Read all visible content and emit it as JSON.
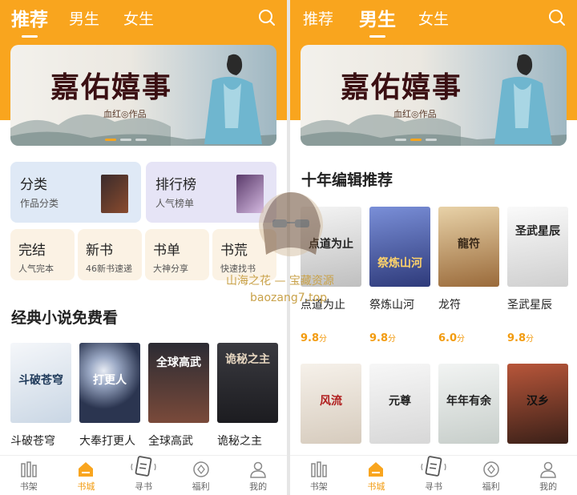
{
  "left": {
    "tabs": [
      {
        "label": "推荐",
        "active": true
      },
      {
        "label": "男生",
        "active": false
      },
      {
        "label": "女生",
        "active": false
      }
    ],
    "banner": {
      "title": "嘉佑嬉事",
      "subtitle": "血红◎作品"
    },
    "categories": [
      {
        "title": "分类",
        "sub": "作品分类"
      },
      {
        "title": "排行榜",
        "sub": "人气榜单"
      }
    ],
    "quick": [
      {
        "title": "完结",
        "sub": "人气完本"
      },
      {
        "title": "新书",
        "sub": "46新书速递"
      },
      {
        "title": "书单",
        "sub": "大神分享"
      },
      {
        "title": "书荒",
        "sub": "快速找书"
      }
    ],
    "section_title": "经典小说免费看",
    "books": [
      {
        "name": "斗破苍穹",
        "cover_text": "斗破苍穹",
        "color": "#dfe7ef"
      },
      {
        "name": "大奉打更人",
        "cover_text": "打更人",
        "color": "#2b3550"
      },
      {
        "name": "全球高武",
        "cover_text": "全球高武",
        "color": "#3b2f2f"
      },
      {
        "name": "诡秘之主",
        "cover_text": "诡秘之主",
        "color": "#2a2a2e"
      }
    ]
  },
  "right": {
    "tabs": [
      {
        "label": "推荐",
        "active": false
      },
      {
        "label": "男生",
        "active": true
      },
      {
        "label": "女生",
        "active": false
      }
    ],
    "banner": {
      "title": "嘉佑嬉事",
      "subtitle": "血红◎作品"
    },
    "section_title": "十年编辑推荐",
    "books_row1": [
      {
        "name": "点道为止",
        "score": "9.8",
        "unit": "分",
        "cover_text": "点道为止",
        "color": "#e9e9e9"
      },
      {
        "name": "祭炼山河",
        "score": "9.8",
        "unit": "分",
        "cover_text": "祭炼山河",
        "color": "#4a5aa8"
      },
      {
        "name": "龙符",
        "score": "6.0",
        "unit": "分",
        "cover_text": "龍符",
        "color": "#c9a46a"
      },
      {
        "name": "圣武星辰",
        "score": "9.8",
        "unit": "分",
        "cover_text": "圣武星辰",
        "color": "#eeeeee"
      }
    ],
    "books_row2": [
      {
        "cover_text": "风流",
        "color": "#f2ede6"
      },
      {
        "cover_text": "元尊",
        "color": "#f3f3f3"
      },
      {
        "cover_text": "年年有余",
        "color": "#eef0ef"
      },
      {
        "cover_text": "汉乡",
        "color": "#6b3b2a"
      }
    ]
  },
  "bottom_nav": [
    {
      "label": "书架",
      "icon": "bookshelf-icon",
      "active": false
    },
    {
      "label": "书城",
      "icon": "bookstore-icon",
      "active": true
    },
    {
      "label": "寻书",
      "icon": "card-search-icon",
      "active": false
    },
    {
      "label": "福利",
      "icon": "coin-icon",
      "active": false
    },
    {
      "label": "我的",
      "icon": "user-icon",
      "active": false
    }
  ],
  "watermark": {
    "line1": "山海之花 — 宝藏资源",
    "line2": "baozang7.top"
  },
  "colors": {
    "accent": "#f9a51e",
    "score": "#f29b0f"
  }
}
